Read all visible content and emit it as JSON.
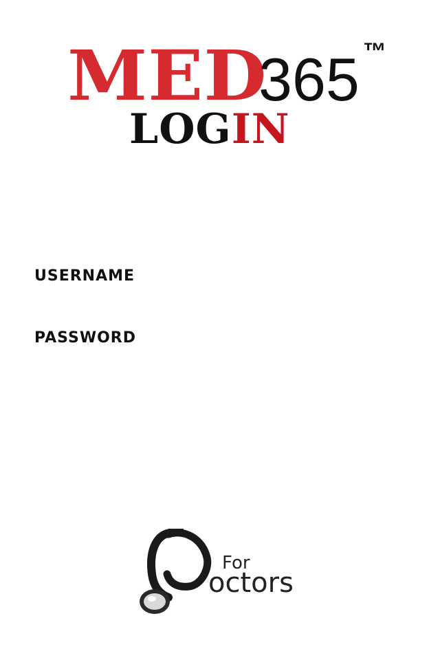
{
  "brand": {
    "med": "MED",
    "number": "365",
    "trademark": "™"
  },
  "login_title": {
    "part1": "LOG",
    "part2": "IN"
  },
  "form": {
    "username_label": "USERNAME",
    "username_value": "",
    "password_label": "PASSWORD",
    "password_value": ""
  },
  "footer": {
    "for_text": "For",
    "doctors_text": "octors",
    "icon": "stethoscope-icon"
  },
  "colors": {
    "brand_red": "#d42a30",
    "text_dark": "#111111",
    "background": "#ffffff"
  }
}
